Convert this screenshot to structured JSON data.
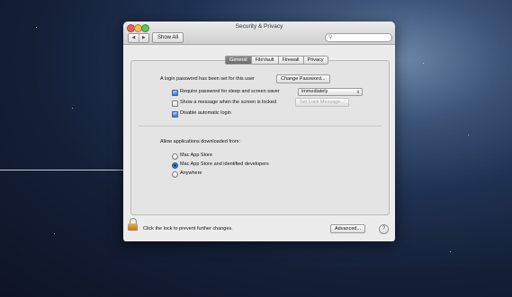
{
  "window": {
    "title": "Security & Privacy"
  },
  "toolbar": {
    "back": "◀",
    "forward": "▶",
    "show_all": "Show All",
    "search_placeholder": ""
  },
  "tabs": [
    {
      "label": "General",
      "selected": true
    },
    {
      "label": "FileVault",
      "selected": false
    },
    {
      "label": "Firewall",
      "selected": false
    },
    {
      "label": "Privacy",
      "selected": false
    }
  ],
  "general": {
    "login_password_text": "A login password has been set for this user",
    "change_password_button": "Change Password...",
    "require_password_label": "Require password for sleep and screen saver",
    "require_password_checked": true,
    "require_password_option": "immediately",
    "show_message_label": "Show a message when the screen is locked",
    "show_message_checked": false,
    "set_lock_message_button": "Set Lock Message...",
    "disable_autologin_label": "Disable automatic login",
    "disable_autologin_checked": true
  },
  "downloads": {
    "heading": "Allow applications downloaded from:",
    "options": [
      {
        "label": "Mac App Store",
        "selected": false
      },
      {
        "label": "Mac App Store and identified developers",
        "selected": true
      },
      {
        "label": "Anywhere",
        "selected": false
      }
    ]
  },
  "footer": {
    "lock_text": "Click the lock to prevent further changes.",
    "advanced_button": "Advanced...",
    "help_button": "?"
  },
  "icons": [
    "lock-icon",
    "search-icon",
    "help-icon",
    "chevron-left-icon",
    "chevron-right-icon",
    "chevron-updown-icon"
  ]
}
